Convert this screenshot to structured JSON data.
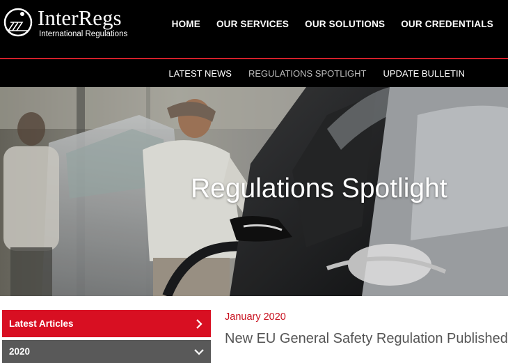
{
  "brand": {
    "name": "InterRegs",
    "tagline": "International Regulations"
  },
  "main_nav": [
    {
      "label": "HOME"
    },
    {
      "label": "OUR SERVICES"
    },
    {
      "label": "OUR SOLUTIONS"
    },
    {
      "label": "OUR CREDENTIALS"
    }
  ],
  "sub_nav": [
    {
      "label": "LATEST NEWS",
      "active": false
    },
    {
      "label": "REGULATIONS SPOTLIGHT",
      "active": true
    },
    {
      "label": "UPDATE BULLETIN",
      "active": false
    }
  ],
  "hero": {
    "title": "Regulations Spotlight"
  },
  "sidebar": {
    "items": [
      {
        "label": "Latest Articles",
        "icon": "chevron-right-icon"
      },
      {
        "label": "2020",
        "icon": "chevron-down-icon"
      }
    ]
  },
  "article": {
    "date": "January 2020",
    "title": "New EU General Safety Regulation Published"
  },
  "colors": {
    "accent": "#d80f22",
    "nav_bg": "#000000",
    "sidebar_gray": "#595959",
    "date_red": "#c8101e"
  }
}
